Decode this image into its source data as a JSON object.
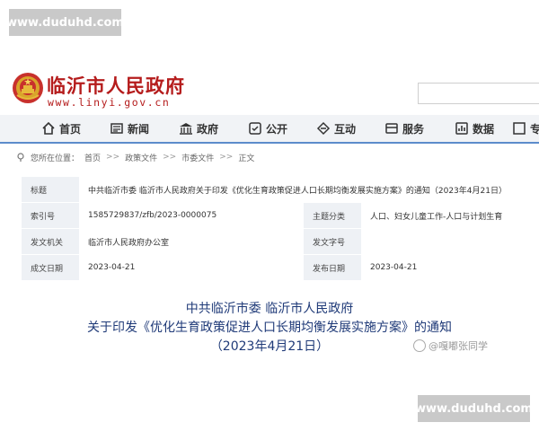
{
  "watermark": {
    "top": "www.duduhd.com",
    "bottom": "www.duduhd.com"
  },
  "header": {
    "site_name": "临沂市人民政府",
    "site_url": "www.linyi.gov.cn"
  },
  "nav": [
    {
      "label": "首页",
      "icon": "home-icon"
    },
    {
      "label": "新闻",
      "icon": "news-icon"
    },
    {
      "label": "政府",
      "icon": "government-icon"
    },
    {
      "label": "公开",
      "icon": "publicity-icon"
    },
    {
      "label": "互动",
      "icon": "interaction-icon"
    },
    {
      "label": "服务",
      "icon": "service-icon"
    },
    {
      "label": "数据",
      "icon": "data-icon"
    },
    {
      "label": "专",
      "icon": "topic-icon"
    }
  ],
  "breadcrumb": {
    "prefix": "您所在位置：",
    "items": [
      "首页",
      "政策文件",
      "市委文件",
      "正文"
    ]
  },
  "info": {
    "title_label": "标题",
    "title_value": "中共临沂市委 临沂市人民政府关于印发《优化生育政策促进人口长期均衡发展实施方案》的通知（2023年4月21日）",
    "index_label": "索引号",
    "index_value": "1585729837/zfb/2023-0000075",
    "topic_label": "主题分类",
    "topic_value": "人口、妇女儿童工作-人口与计划生育",
    "issuer_label": "发文机关",
    "issuer_value": "临沂市人民政府办公室",
    "docno_label": "发文字号",
    "docno_value": "",
    "created_label": "成文日期",
    "created_value": "2023-04-21",
    "published_label": "发布日期",
    "published_value": "2023-04-21"
  },
  "document": {
    "line1": "中共临沂市委 临沂市人民政府",
    "line2": "关于印发《优化生育政策促进人口长期均衡发展实施方案》的通知",
    "line3": "（2023年4月21日）"
  },
  "source_tag": "@嘎嘟张同学",
  "colors": {
    "brand_red": "#b51c1c",
    "nav_border": "#5c8ccb",
    "title_blue": "#1f3a78",
    "label_bg": "#eef1f5"
  }
}
